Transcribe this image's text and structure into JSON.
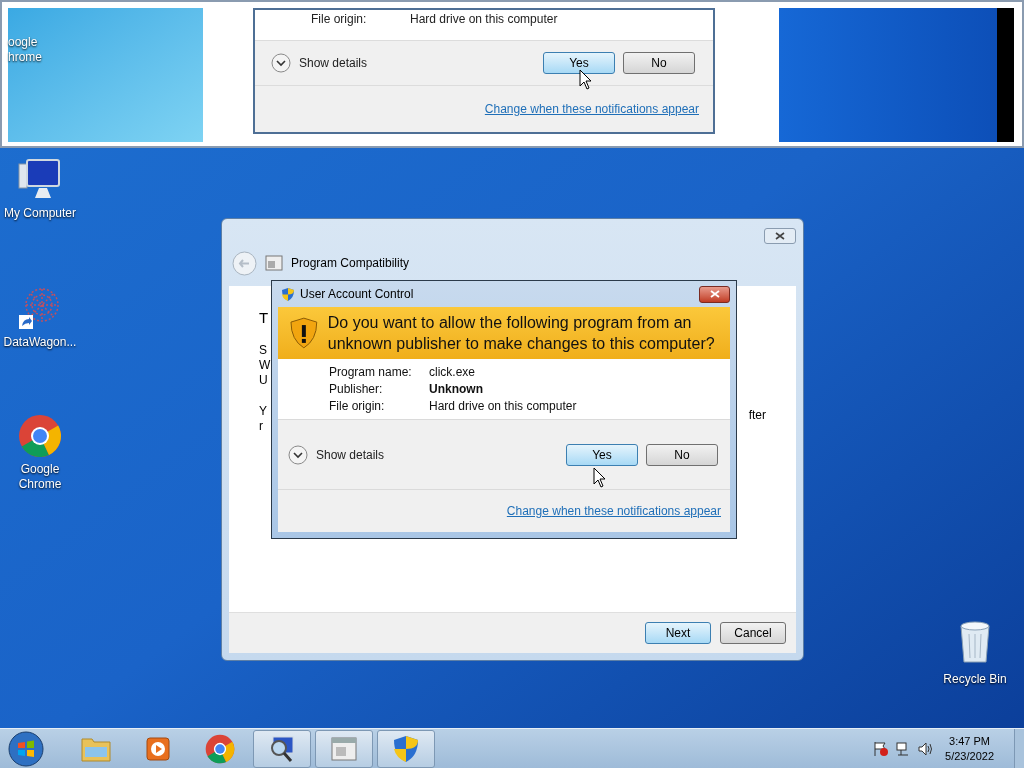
{
  "inset": {
    "desktop_label_lines": [
      "oogle",
      "hrome"
    ],
    "dialog": {
      "field_label": "File origin:",
      "field_value": "Hard drive on this computer",
      "details_toggle": "Show details",
      "buttons": [
        {
          "label": "Yes",
          "focused": true
        },
        {
          "label": "No",
          "focused": false
        }
      ],
      "link": "Change when these notifications appear"
    }
  },
  "desktop_icons": [
    {
      "kind": "computer",
      "label": "My Computer"
    },
    {
      "kind": "shortcut-app",
      "label": "DataWagon..."
    },
    {
      "kind": "chrome",
      "label": "Google Chrome"
    }
  ],
  "recycle_bin": {
    "label": "Recycle Bin"
  },
  "wizard": {
    "title": "Program Compatibility",
    "left_fragments": [
      "T",
      "S",
      "W",
      "U",
      "Y",
      "r"
    ],
    "right_fragment": "fter",
    "buttons": [
      {
        "label": "Next",
        "focused": true
      },
      {
        "label": "Cancel",
        "focused": false
      }
    ]
  },
  "uac": {
    "title": "User Account Control",
    "question": "Do you want to allow the following program from an unknown publisher to make changes to this computer?",
    "fields": [
      {
        "label": "Program name:",
        "value": "click.exe",
        "bold": false
      },
      {
        "label": "Publisher:",
        "value": "Unknown",
        "bold": true
      },
      {
        "label": "File origin:",
        "value": "Hard drive on this computer",
        "bold": false
      }
    ],
    "details_toggle": "Show details",
    "buttons": [
      {
        "label": "Yes",
        "focused": true
      },
      {
        "label": "No",
        "focused": false
      }
    ],
    "link": "Change when these notifications appear"
  },
  "taskbar": {
    "items": [
      {
        "kind": "folder",
        "open": false
      },
      {
        "kind": "media",
        "open": false
      },
      {
        "kind": "chrome",
        "open": false
      },
      {
        "kind": "magnifier",
        "open": true
      },
      {
        "kind": "window",
        "open": true
      },
      {
        "kind": "shield",
        "open": true
      }
    ],
    "time": "3:47 PM",
    "date": "5/23/2022"
  }
}
